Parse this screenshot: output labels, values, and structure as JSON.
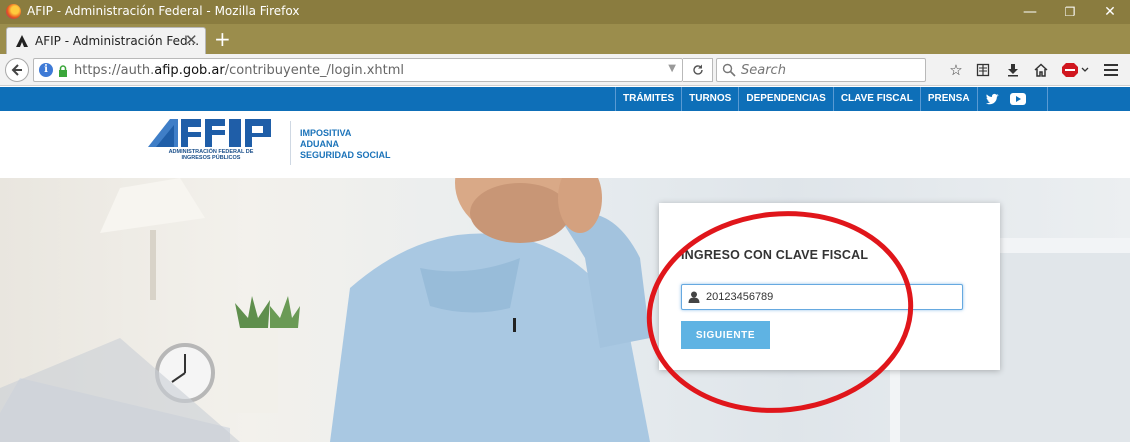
{
  "browser": {
    "window_title": "AFIP - Administración Federal - Mozilla Firefox",
    "window_controls": {
      "minimize": "—",
      "restore": "❐",
      "close": "✕"
    },
    "tab": {
      "label": "AFIP - Administración Fed...",
      "close": "✕"
    },
    "new_tab": "+",
    "url": {
      "prefix": "https://auth.",
      "domain": "afip.gob.ar",
      "path": "/contribuyente_/login.xhtml"
    },
    "search_placeholder": "Search",
    "info_glyph": "i"
  },
  "site": {
    "nav": [
      "TRÁMITES",
      "TURNOS",
      "DEPENDENCIAS",
      "CLAVE FISCAL",
      "PRENSA"
    ],
    "logo_subtitle_line1": "ADMINISTRACIÓN FEDERAL DE",
    "logo_subtitle_line2": "INGRESOS PÚBLICOS",
    "services": [
      "IMPOSITIVA",
      "ADUANA",
      "SEGURIDAD SOCIAL"
    ],
    "brand_color": "#0e6fb8",
    "accent_color": "#1b73b9"
  },
  "login": {
    "title": "INGRESO CON CLAVE FISCAL",
    "cuit_value": "20123456789",
    "button_label": "SIGUIENTE",
    "button_color": "#5fb3e3"
  },
  "annotation": {
    "color": "#e0161b",
    "shape": "ellipse"
  }
}
